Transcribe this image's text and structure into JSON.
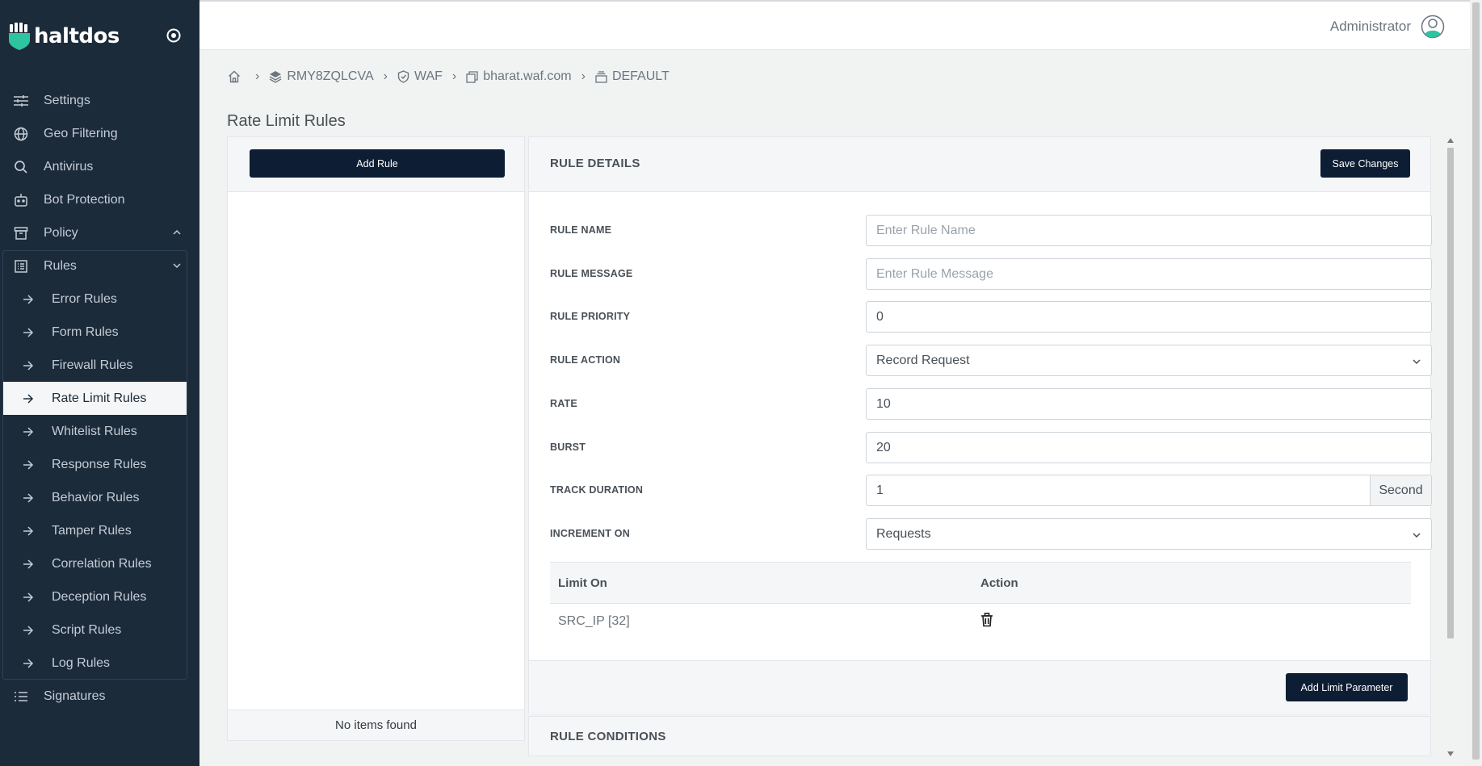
{
  "brand": {
    "name": "haltdos"
  },
  "header": {
    "user": "Administrator"
  },
  "breadcrumb": {
    "items": [
      "RMY8ZQLCVA",
      "WAF",
      "bharat.waf.com",
      "DEFAULT"
    ]
  },
  "page": {
    "title": "Rate Limit Rules"
  },
  "sidebar": {
    "items": [
      {
        "label": "Settings",
        "icon": "sliders-icon"
      },
      {
        "label": "Geo Filtering",
        "icon": "globe-icon"
      },
      {
        "label": "Antivirus",
        "icon": "search-icon"
      },
      {
        "label": "Bot Protection",
        "icon": "robot-icon"
      },
      {
        "label": "Policy",
        "icon": "archive-icon"
      },
      {
        "label": "Rules",
        "icon": "list-icon"
      }
    ],
    "rules": [
      "Error Rules",
      "Form Rules",
      "Firewall Rules",
      "Rate Limit Rules",
      "Whitelist Rules",
      "Response Rules",
      "Behavior Rules",
      "Tamper Rules",
      "Correlation Rules",
      "Deception Rules",
      "Script Rules",
      "Log Rules"
    ],
    "signatures": "Signatures",
    "active": "Rate Limit Rules"
  },
  "left_panel": {
    "add_rule": "Add Rule",
    "empty": "No items found"
  },
  "rule_details": {
    "title": "RULE DETAILS",
    "save": "Save Changes",
    "name_label": "RULE NAME",
    "name_placeholder": "Enter Rule Name",
    "message_label": "RULE MESSAGE",
    "message_placeholder": "Enter Rule Message",
    "priority_label": "RULE PRIORITY",
    "priority_value": "0",
    "action_label": "RULE ACTION",
    "action_value": "Record Request",
    "rate_label": "RATE",
    "rate_value": "10",
    "burst_label": "BURST",
    "burst_value": "20",
    "track_label": "TRACK DURATION",
    "track_value": "1",
    "track_unit": "Second",
    "increment_label": "INCREMENT ON",
    "increment_value": "Requests"
  },
  "limit_table": {
    "headers": [
      "Limit On",
      "Action"
    ],
    "rows": [
      {
        "limit_on": "SRC_IP [32]"
      }
    ],
    "add_button": "Add Limit Parameter"
  },
  "conditions": {
    "title": "RULE CONDITIONS"
  },
  "colors": {
    "sidebar": "#1c2b3a",
    "brand_accent": "#2ec4a0",
    "button": "#0d1d33"
  }
}
